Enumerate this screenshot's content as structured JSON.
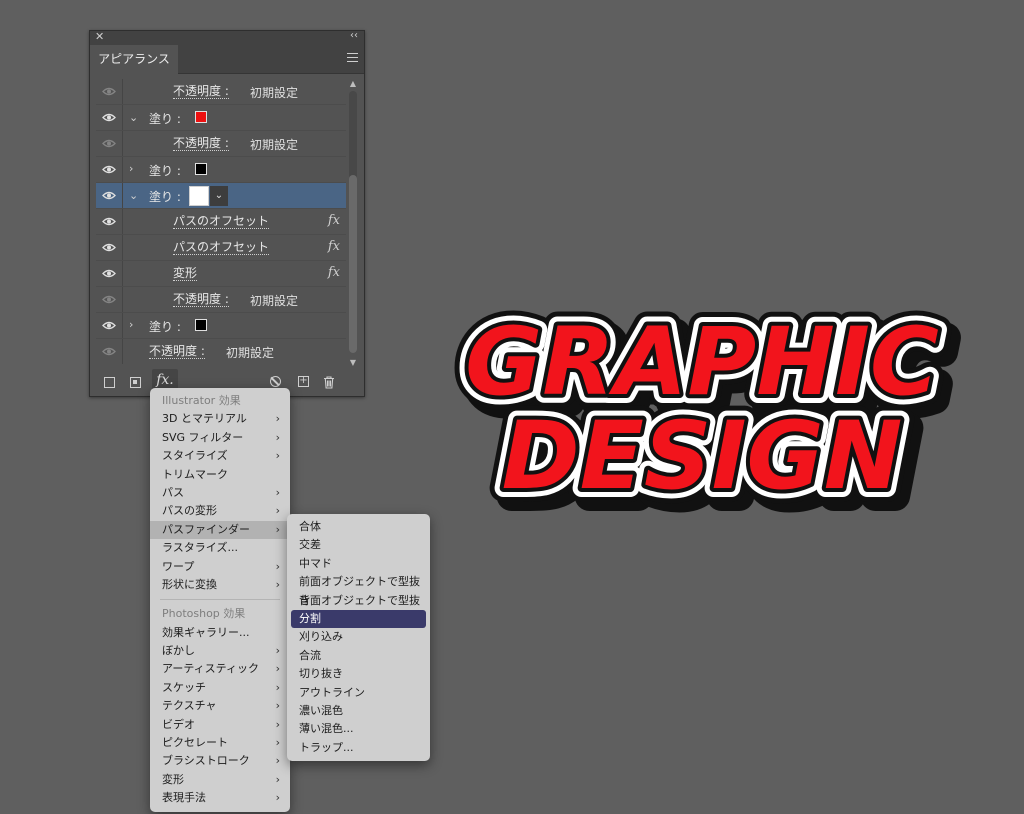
{
  "panel": {
    "tab": "アピアランス",
    "rows": [
      {
        "label": "不透明度 :",
        "value": "初期設定"
      },
      {
        "label": "塗り :"
      },
      {
        "label": "不透明度 :",
        "value": "初期設定"
      },
      {
        "label": "塗り :"
      },
      {
        "label": "塗り :"
      },
      {
        "label": "パスのオフセット",
        "fx": "fx"
      },
      {
        "label": "パスのオフセット",
        "fx": "fx"
      },
      {
        "label": "変形",
        "fx": "fx"
      },
      {
        "label": "不透明度 :",
        "value": "初期設定"
      },
      {
        "label": "塗り :"
      },
      {
        "label": "不透明度 :",
        "value": "初期設定"
      }
    ],
    "fx_button": "fx."
  },
  "effects_menu": {
    "illustrator_header": "Illustrator 効果",
    "illustrator_items": [
      "3D とマテリアル",
      "SVG フィルター",
      "スタイライズ",
      "トリムマーク",
      "パス",
      "パスの変形",
      "パスファインダー",
      "ラスタライズ...",
      "ワープ",
      "形状に変換"
    ],
    "photoshop_header": "Photoshop 効果",
    "photoshop_items": [
      "効果ギャラリー...",
      "ぼかし",
      "アーティスティック",
      "スケッチ",
      "テクスチャ",
      "ビデオ",
      "ピクセレート",
      "ブラシストローク",
      "変形",
      "表現手法"
    ]
  },
  "pathfinder_menu": {
    "items": [
      "合体",
      "交差",
      "中マド",
      "前面オブジェクトで型抜き",
      "背面オブジェクトで型抜き",
      "分割",
      "刈り込み",
      "合流",
      "切り抜き",
      "アウトライン",
      "濃い混色",
      "薄い混色...",
      "トラップ..."
    ],
    "selected": "分割"
  },
  "artwork": {
    "line1": "GRAPHIC",
    "line2": "DESIGN",
    "fill_color": "#f2141c",
    "stroke_color": "#111111",
    "outline_color": "#ffffff"
  }
}
